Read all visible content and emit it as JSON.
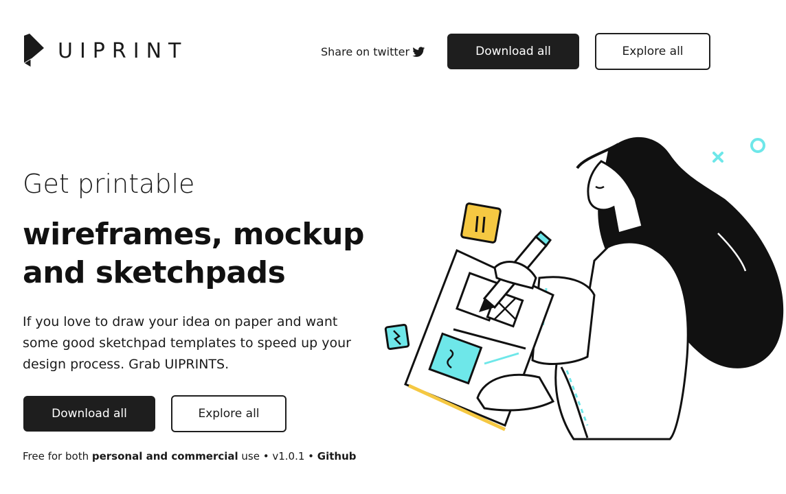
{
  "brand": {
    "name": "UIPRINT"
  },
  "header": {
    "share_label": "Share on twitter",
    "download_label": "Download all",
    "explore_label": "Explore all"
  },
  "hero": {
    "pre_title": "Get printable",
    "title_line1": "wireframes, mockup",
    "title_line2": "and sketchpads",
    "description": "If you love to draw your idea on paper and want some good sketchpad templates to speed up your design process. Grab UIPRINTS.",
    "download_label": "Download all",
    "explore_label": "Explore all"
  },
  "footnote": {
    "part1": "Free for both ",
    "bold1": "personal and commercial",
    "part2": " use • v1.0.1 • ",
    "github": "Github"
  },
  "colors": {
    "dark": "#1e1e1e",
    "accent_cyan": "#6ee7e9",
    "accent_yellow": "#f5c842"
  },
  "icons": [
    "uiprint-logo-icon",
    "twitter-icon"
  ]
}
